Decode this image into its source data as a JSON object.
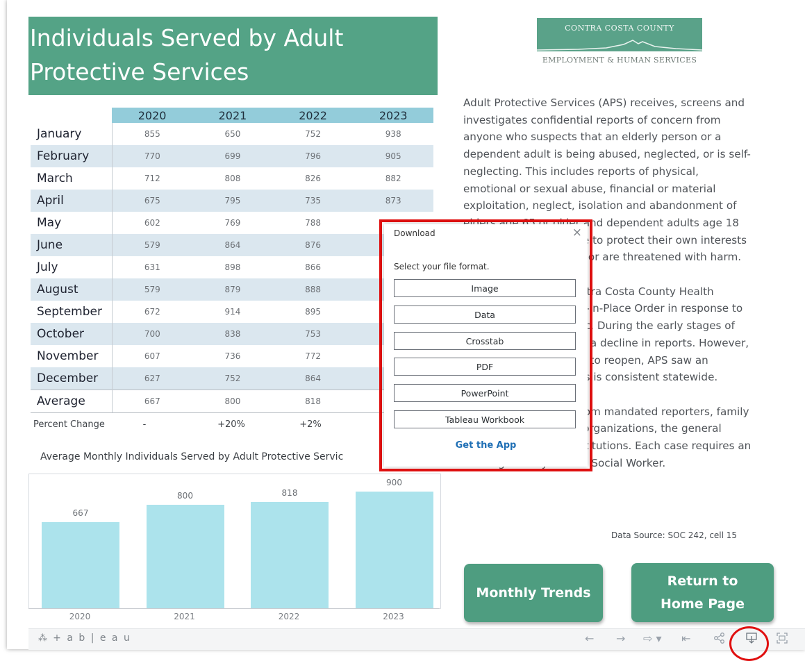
{
  "title": "Individuals Served by Adult Protective Services",
  "table": {
    "years": [
      "2020",
      "2021",
      "2022",
      "2023"
    ],
    "rows": [
      {
        "month": "January",
        "values": [
          "855",
          "650",
          "752",
          "938"
        ]
      },
      {
        "month": "February",
        "values": [
          "770",
          "699",
          "796",
          "905"
        ]
      },
      {
        "month": "March",
        "values": [
          "712",
          "808",
          "826",
          "882"
        ]
      },
      {
        "month": "April",
        "values": [
          "675",
          "795",
          "735",
          "873"
        ]
      },
      {
        "month": "May",
        "values": [
          "602",
          "769",
          "788",
          ""
        ]
      },
      {
        "month": "June",
        "values": [
          "579",
          "864",
          "876",
          ""
        ]
      },
      {
        "month": "July",
        "values": [
          "631",
          "898",
          "866",
          ""
        ]
      },
      {
        "month": "August",
        "values": [
          "579",
          "879",
          "888",
          ""
        ]
      },
      {
        "month": "September",
        "values": [
          "672",
          "914",
          "895",
          ""
        ]
      },
      {
        "month": "October",
        "values": [
          "700",
          "838",
          "753",
          ""
        ]
      },
      {
        "month": "November",
        "values": [
          "607",
          "736",
          "772",
          ""
        ]
      },
      {
        "month": "December",
        "values": [
          "627",
          "752",
          "864",
          ""
        ]
      },
      {
        "month": "Average",
        "values": [
          "667",
          "800",
          "818",
          ""
        ]
      }
    ],
    "percent_change": {
      "label": "Percent Change",
      "values": [
        "-",
        "+20%",
        "+2%",
        "-"
      ]
    }
  },
  "chart_title": "Average Monthly Individuals Served by Adult Protective Servic",
  "chart_data": {
    "type": "bar",
    "categories": [
      "2020",
      "2021",
      "2022",
      "2023"
    ],
    "values": [
      667,
      800,
      818,
      900
    ],
    "title": "Average Monthly Individuals Served by Adult Protective Servic",
    "xlabel": "",
    "ylabel": "",
    "ylim": [
      0,
      1000
    ]
  },
  "logo": {
    "line1": "CONTRA COSTA COUNTY",
    "line2": "EMPLOYMENT & HUMAN SERVICES"
  },
  "description": {
    "p1": "Adult Protective Services (APS) receives, screens and investigates confidential reports of concern from anyone who suspects that an elderly person or a dependent adult is being abused, neglected, or is self-neglecting. This includes reports of physical, emotional or sexual abuse, financial or material exploitation, neglect, isolation and abandonment of elders age 65 or older and dependent adults age 18 or older who are unable to protect their own interests because of a disability, or are threatened with harm.",
    "p2": "In March 2020, the Contra Costa County Health Officer issued a Shelter-in-Place Order in response to the COVID-19 pandemic. During the early stages of the pandemic, APS saw a decline in reports. However, once the County began to reopen, APS saw an increase in reports. This is consistent statewide.",
    "p3": "Reports are received from mandated reporters, family members, community organizations, the general public and financial institutions. Each case requires an investigation by an APS Social Worker."
  },
  "data_source": "Data Source: SOC 242, cell 15",
  "buttons": {
    "monthly_trends": "Monthly Trends",
    "return_home": "Return to Home Page"
  },
  "dialog": {
    "title": "Download",
    "close": "×",
    "subtitle": "Select your file format.",
    "formats": [
      "Image",
      "Data",
      "Crosstab",
      "PDF",
      "PowerPoint",
      "Tableau Workbook"
    ],
    "link": "Get the App"
  },
  "toolbar": {
    "logo": "+ a b | e a u",
    "icons": [
      "undo-icon",
      "redo-icon",
      "revert-icon",
      "revert-all-icon",
      "share-icon",
      "download-icon",
      "fullscreen-icon"
    ]
  },
  "colors": {
    "title_bg": "#54a386",
    "header_bg": "#93ccda",
    "bar": "#ace3ec",
    "button": "#4e9d80",
    "highlight": "#e01010",
    "link": "#1f6fb5"
  }
}
